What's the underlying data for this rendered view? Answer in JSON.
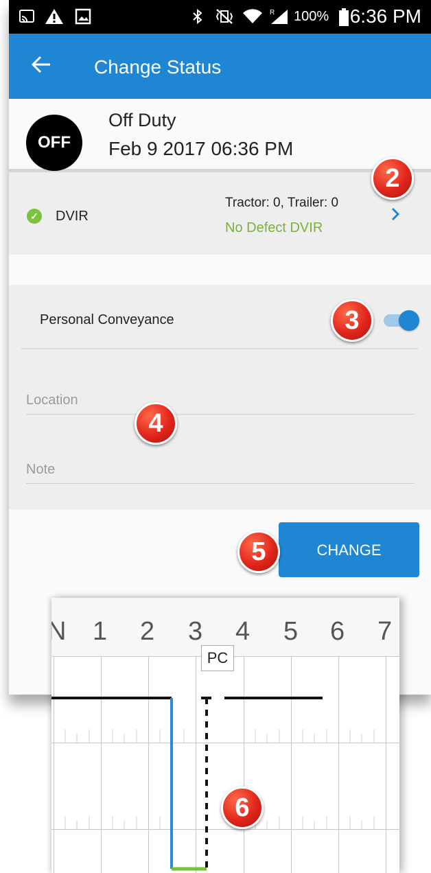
{
  "status_bar": {
    "icons": [
      "cast-icon",
      "warning-icon",
      "image-icon",
      "bluetooth-icon",
      "vibrate-off-icon",
      "wifi-icon",
      "signal-icon",
      "battery-icon"
    ],
    "battery": "100%",
    "time": "6:36 PM"
  },
  "app_bar": {
    "back_icon": "back-arrow-icon",
    "title": "Change Status"
  },
  "current_status": {
    "badge": "OFF",
    "name": "Off Duty",
    "timestamp": "Feb 9 2017 06:36 PM"
  },
  "dvir": {
    "label": "DVIR",
    "counts": "Tractor: 0, Trailer: 0",
    "result": "No Defect DVIR"
  },
  "personal_conveyance": {
    "label": "Personal Conveyance",
    "enabled": true
  },
  "form": {
    "location_placeholder": "Location",
    "note_placeholder": "Note"
  },
  "change_button": "CHANGE",
  "log_graph": {
    "hour_labels": [
      "N",
      "1",
      "2",
      "3",
      "4",
      "5",
      "6",
      "7"
    ],
    "pc_marker": "PC"
  },
  "callouts": [
    "2",
    "3",
    "4",
    "5",
    "6"
  ],
  "colors": {
    "primary": "#1f86d3",
    "success": "#7cc241",
    "callout": "#e1261c"
  }
}
